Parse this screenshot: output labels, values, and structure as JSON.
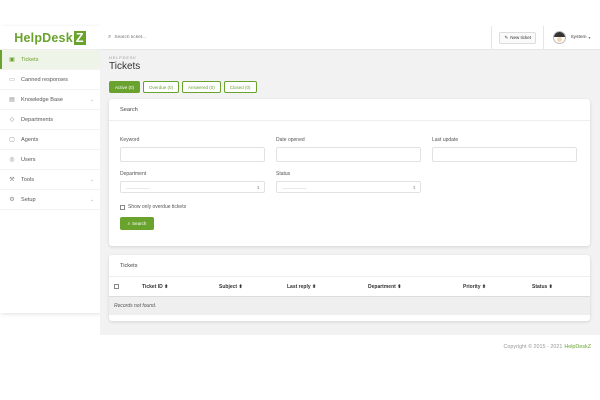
{
  "brand": {
    "logo_main": "HelpDesk",
    "logo_z": "Z",
    "color": "#6aa22e"
  },
  "sidebar": {
    "items": [
      {
        "label": "Tickets",
        "icon": "tickets-icon",
        "active": true
      },
      {
        "label": "Canned responses",
        "icon": "chat-icon"
      },
      {
        "label": "Knowledge Base",
        "icon": "book-icon",
        "chevron": true
      },
      {
        "label": "Departments",
        "icon": "departments-icon"
      },
      {
        "label": "Agents",
        "icon": "agents-icon"
      },
      {
        "label": "Users",
        "icon": "users-icon"
      },
      {
        "label": "Tools",
        "icon": "tools-icon",
        "chevron": true
      },
      {
        "label": "Setup",
        "icon": "setup-icon",
        "chevron": true
      }
    ]
  },
  "topbar": {
    "search_placeholder": "Search ticket...",
    "new_ticket_label": "New ticket",
    "user_name": "System"
  },
  "main": {
    "breadcrumb": "HELPDESK",
    "title": "Tickets",
    "tabs": [
      {
        "label": "Active (0)",
        "active": true
      },
      {
        "label": "Overdue (0)"
      },
      {
        "label": "Answered (0)"
      },
      {
        "label": "Closed (0)"
      }
    ]
  },
  "search_form": {
    "heading": "Search",
    "keyword_label": "Keyword",
    "date_opened_label": "Date opened",
    "last_update_label": "Last update",
    "department_label": "Department",
    "department_value": "------------------",
    "status_label": "Status",
    "status_value": "------------------",
    "overdue_label": "Show only overdue tickets",
    "search_button": "Search"
  },
  "tickets_table": {
    "heading": "Tickets",
    "columns": [
      "Ticket ID",
      "Subject",
      "Last reply",
      "Department",
      "Priority",
      "Status"
    ],
    "empty_text": "Records not found."
  },
  "footer": {
    "copyright": "Copyright © 2015 - 2021",
    "brand": "HelpDeskZ"
  }
}
